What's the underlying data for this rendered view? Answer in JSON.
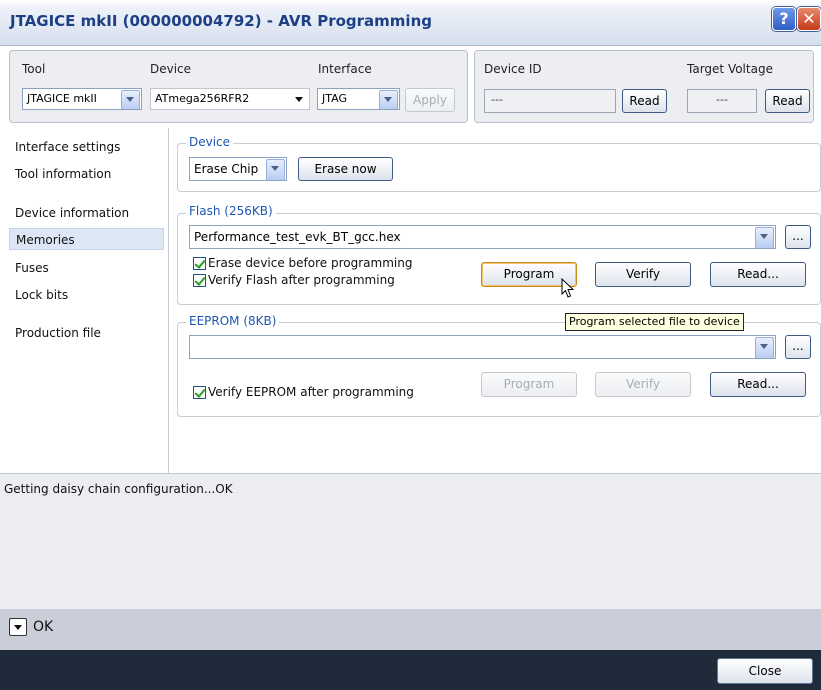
{
  "window": {
    "title": "JTAGICE mkII (000000004792) - AVR Programming",
    "help_label": "?",
    "close_glyph": "✕"
  },
  "toolbar": {
    "tool_label": "Tool",
    "tool_value": "JTAGICE mkII",
    "device_label": "Device",
    "device_value": "ATmega256RFR2",
    "interface_label": "Interface",
    "interface_value": "JTAG",
    "apply_label": "Apply",
    "device_id_label": "Device ID",
    "device_id_value": "---",
    "device_id_read": "Read",
    "voltage_label": "Target Voltage",
    "voltage_value": "---",
    "voltage_read": "Read"
  },
  "sidebar": {
    "items": [
      {
        "label": "Interface settings"
      },
      {
        "label": "Tool information"
      },
      {
        "label": "Device information"
      },
      {
        "label": "Memories"
      },
      {
        "label": "Fuses"
      },
      {
        "label": "Lock bits"
      },
      {
        "label": "Production file"
      }
    ],
    "selected": "Memories"
  },
  "device_group": {
    "title": "Device",
    "erase_select": "Erase Chip",
    "erase_now": "Erase now"
  },
  "flash_group": {
    "title": "Flash (256KB)",
    "file": "Performance_test_evk_BT_gcc.hex",
    "browse": "...",
    "erase_before": "Erase device before programming",
    "verify_after": "Verify Flash after programming",
    "program": "Program",
    "verify": "Verify",
    "read": "Read..."
  },
  "tooltip": {
    "text": "Program selected file to device"
  },
  "eeprom_group": {
    "title": "EEPROM (8KB)",
    "file": "",
    "browse": "...",
    "verify_after": "Verify EEPROM after programming",
    "program": "Program",
    "verify": "Verify",
    "read": "Read..."
  },
  "log": {
    "text": "Getting daisy chain configuration...OK"
  },
  "status": {
    "text": "OK"
  },
  "footer": {
    "close": "Close"
  }
}
